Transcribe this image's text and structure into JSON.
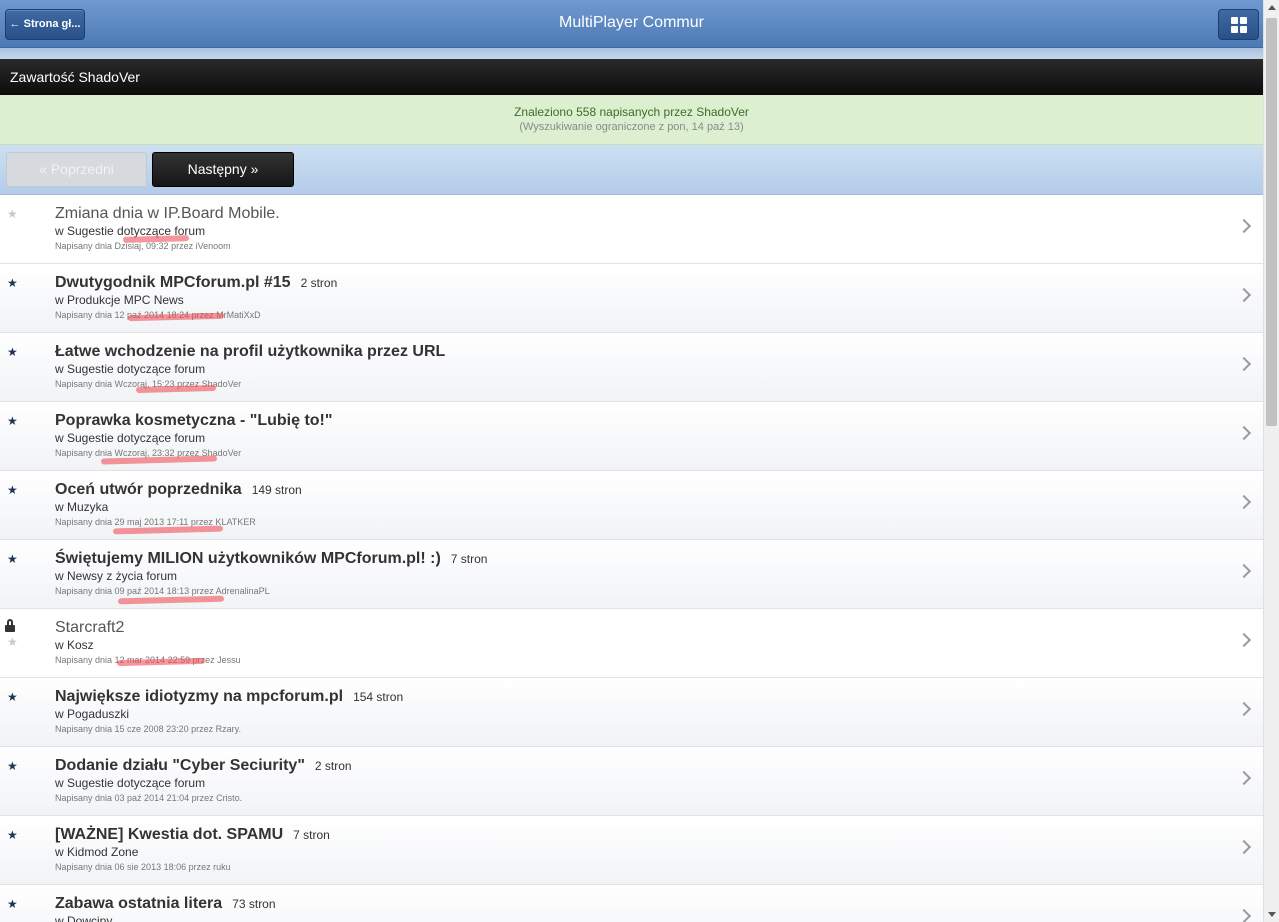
{
  "header": {
    "back_label": "← Strona gł...",
    "title": "MultiPlayer Commur",
    "menu_icon": "grid-icon"
  },
  "section_title": "Zawartość ShadoVer",
  "notice": {
    "main": "Znaleziono 558 napisanych przez ShadoVer",
    "sub": "(Wyszukiwanie ograniczone z pon, 14 paź 13)"
  },
  "pager": {
    "prev_label": "« Poprzedni",
    "next_label": "Następny »"
  },
  "topics": [
    {
      "title": "Zmiana dnia w IP.Board Mobile.",
      "pages": "",
      "forum": "w Sugestie dotyczące forum",
      "meta": "Napisany dnia Dzisiaj, 09:32 przez iVenoom",
      "starred": false,
      "locked": false,
      "read": true
    },
    {
      "title": "Dwutygodnik MPCforum.pl #15",
      "pages": "2 stron",
      "forum": "w Produkcje MPC News",
      "meta": "Napisany dnia 12 paź 2014 18:24 przez MrMatiXxD",
      "starred": true,
      "locked": false,
      "read": false
    },
    {
      "title": "Łatwe wchodzenie na profil użytkownika przez URL",
      "pages": "",
      "forum": "w Sugestie dotyczące forum",
      "meta": "Napisany dnia Wczoraj, 15:23 przez ShadoVer",
      "starred": true,
      "locked": false,
      "read": false
    },
    {
      "title": "Poprawka kosmetyczna - \"Lubię to!\"",
      "pages": "",
      "forum": "w Sugestie dotyczące forum",
      "meta": "Napisany dnia Wczoraj, 23:32 przez ShadoVer",
      "starred": true,
      "locked": false,
      "read": false
    },
    {
      "title": "Oceń utwór poprzednika",
      "pages": "149 stron",
      "forum": "w Muzyka",
      "meta": "Napisany dnia 29 maj 2013 17:11 przez KLATKER",
      "starred": true,
      "locked": false,
      "read": false
    },
    {
      "title": "Świętujemy MILION użytkowników MPCforum.pl! :)",
      "pages": "7 stron",
      "forum": "w Newsy z życia forum",
      "meta": "Napisany dnia 09 paź 2014 18:13 przez AdrenalinaPL",
      "starred": true,
      "locked": false,
      "read": false
    },
    {
      "title": "Starcraft2",
      "pages": "",
      "forum": "w Kosz",
      "meta": "Napisany dnia 12 mar 2014 22:59 przez Jessu",
      "starred": false,
      "locked": true,
      "read": true
    },
    {
      "title": "Największe idiotyzmy na mpcforum.pl",
      "pages": "154 stron",
      "forum": "w Pogaduszki",
      "meta": "Napisany dnia 15 cze 2008 23:20 przez Rzary.",
      "starred": true,
      "locked": false,
      "read": false
    },
    {
      "title": "Dodanie działu \"Cyber Seciurity\"",
      "pages": "2 stron",
      "forum": "w Sugestie dotyczące forum",
      "meta": "Napisany dnia 03 paź 2014 21:04 przez Cristo.",
      "starred": true,
      "locked": false,
      "read": false
    },
    {
      "title": "[WAŻNE] Kwestia dot. SPAMU",
      "pages": "7 stron",
      "forum": "w Kidmod Zone",
      "meta": "Napisany dnia 06 sie 2013 18:06 przez ruku",
      "starred": true,
      "locked": false,
      "read": false
    },
    {
      "title": "Zabawa ostatnia litera",
      "pages": "73 stron",
      "forum": "w Dowcipy",
      "meta": "",
      "starred": true,
      "locked": false,
      "read": false
    }
  ]
}
